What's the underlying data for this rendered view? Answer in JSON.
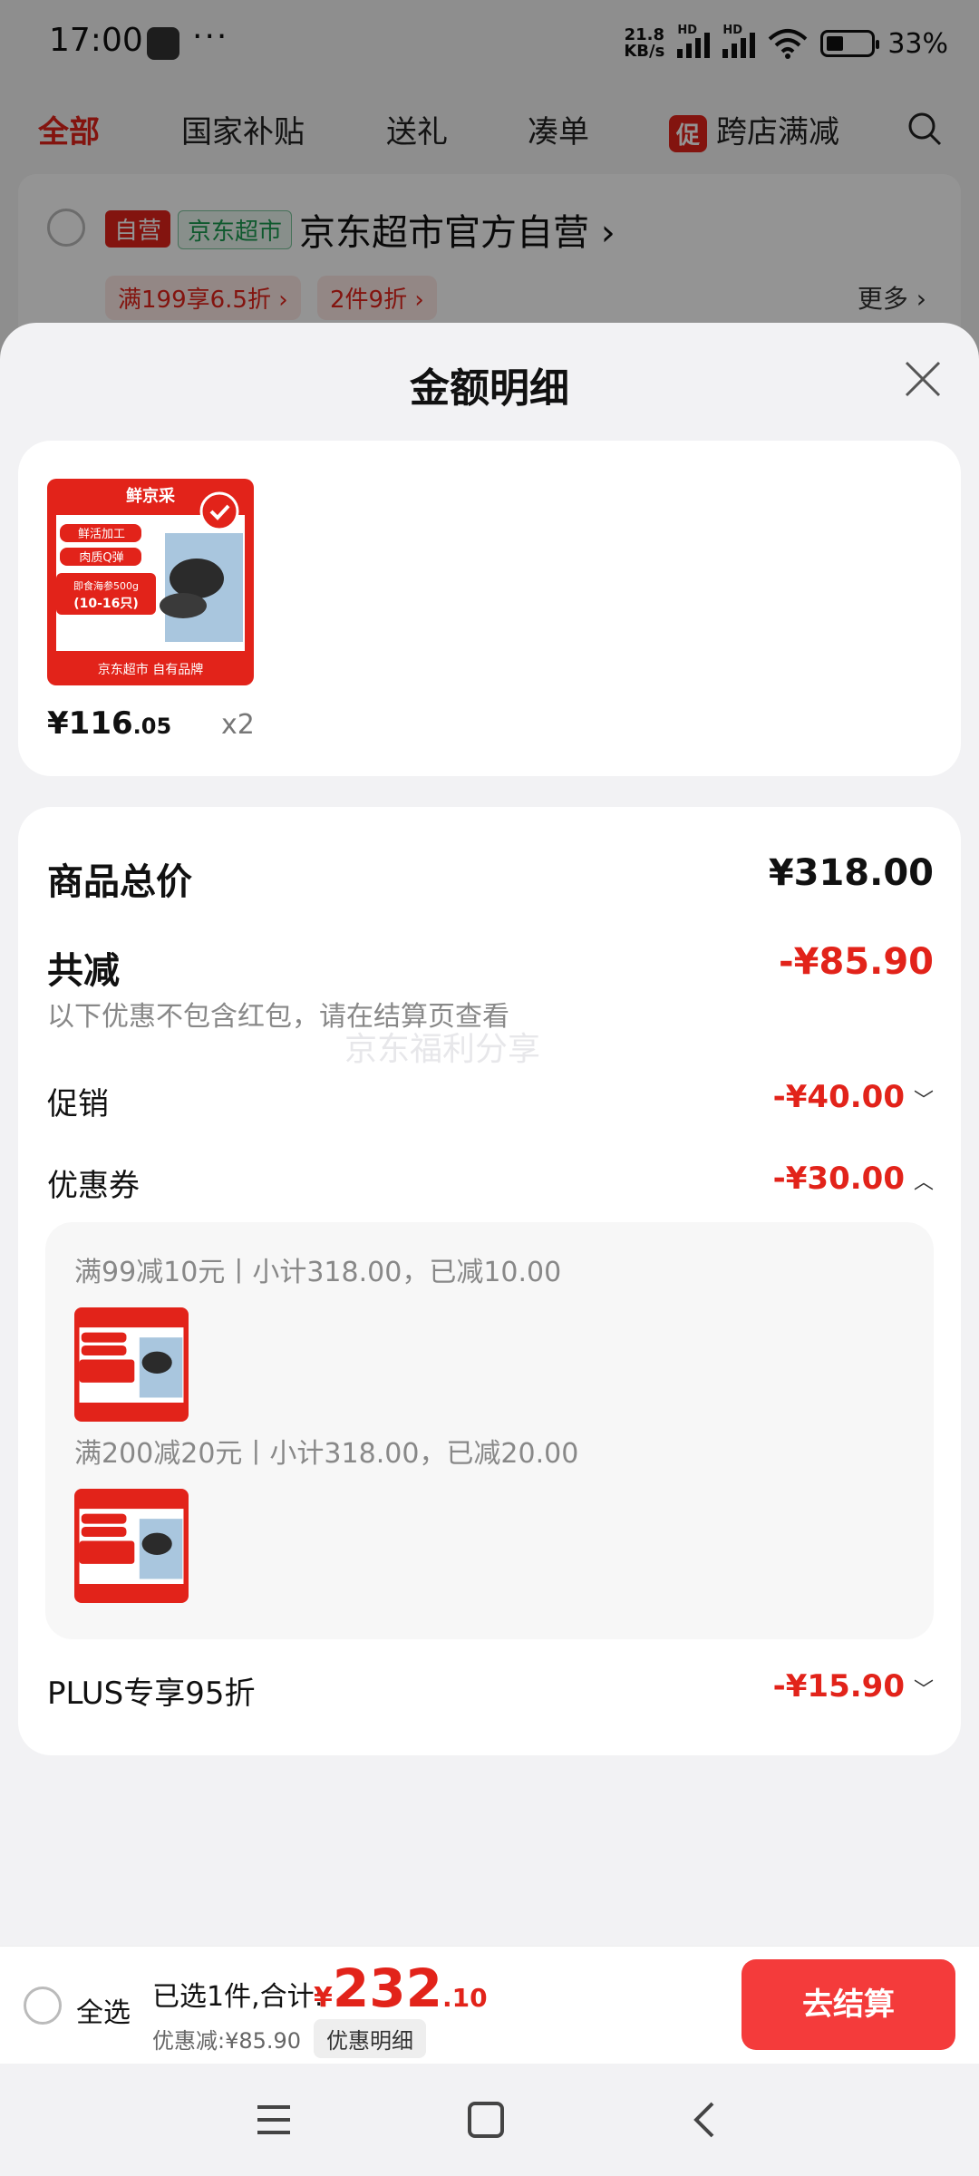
{
  "status_bar": {
    "time": "17:00",
    "dots": "···",
    "net_speed_top": "21.8",
    "net_speed_bottom": "KB/s",
    "hd_label": "HD",
    "battery_pct": "33%"
  },
  "tabs": [
    {
      "label": "全部",
      "active": true
    },
    {
      "label": "国家补贴"
    },
    {
      "label": "送礼"
    },
    {
      "label": "凑单"
    },
    {
      "label": "跨店满减",
      "badge": "促"
    }
  ],
  "store": {
    "tag_self": "自营",
    "tag_market": "京东超市",
    "name": "京东超市官方自营 ›",
    "coupons": [
      "满199享6.5折 ›",
      "2件9折 ›"
    ],
    "more": "更多 ›"
  },
  "sheet": {
    "title": "金额明细",
    "product": {
      "thumb_brand": "鲜京采",
      "thumb_tag1": "鲜活加工",
      "thumb_tag2": "肉质Q弹",
      "thumb_weight": "即食海参500g",
      "thumb_count": "(10-16只)",
      "thumb_footer": "京东超市 自有品牌",
      "price_int": "¥116",
      "price_dec": ".05",
      "qty": "x2"
    },
    "total_label": "商品总价",
    "total_value": "¥318.00",
    "reduce_label": "共减",
    "reduce_value": "-¥85.90",
    "note": "以下优惠不包含红包，请在结算页查看",
    "watermark": "京东福利分享",
    "promo_label": "促销",
    "promo_value": "-¥40.00",
    "coupon_label": "优惠券",
    "coupon_value": "-¥30.00",
    "coupon_details": [
      "满99减10元丨小计318.00，已减10.00",
      "满200减20元丨小计318.00，已减20.00"
    ],
    "plus_label": "PLUS专享95折",
    "plus_value": "-¥15.90"
  },
  "bottom_bar": {
    "select_all": "全选",
    "summary": "已选1件,合计:",
    "total_currency": "¥",
    "total_int": "232",
    "total_dec": ".10",
    "discount": "优惠减:¥85.90",
    "detail_chip": "优惠明细",
    "checkout": "去结算"
  },
  "colors": {
    "accent_red": "#e2231a",
    "checkout_red": "#f43b3b"
  }
}
